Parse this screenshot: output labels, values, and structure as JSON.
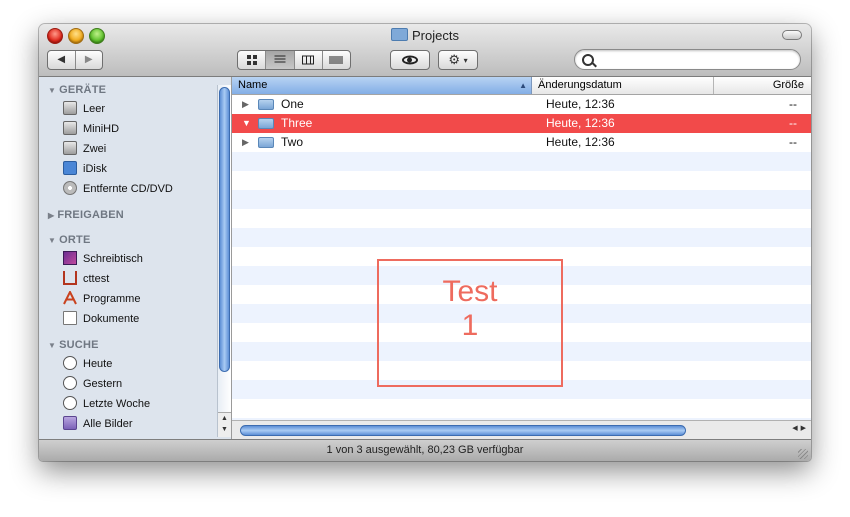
{
  "window": {
    "title": "Projects"
  },
  "toolbar": {
    "back_glyph": "◀",
    "forward_glyph": "▶",
    "action_glyph": "⚙",
    "action_arrow": "▾",
    "search_value": ""
  },
  "sidebar": {
    "sections": [
      {
        "label": "GERÄTE",
        "expanded": true
      },
      {
        "label": "FREIGABEN",
        "expanded": false
      },
      {
        "label": "ORTE",
        "expanded": true
      },
      {
        "label": "SUCHE",
        "expanded": true
      }
    ],
    "devices": [
      "Leer",
      "MiniHD",
      "Zwei",
      "iDisk",
      "Entfernte CD/DVD"
    ],
    "places": [
      "Schreibtisch",
      "cttest",
      "Programme",
      "Dokumente"
    ],
    "searches": [
      "Heute",
      "Gestern",
      "Letzte Woche",
      "Alle Bilder"
    ]
  },
  "list": {
    "columns": {
      "name": "Name",
      "date": "Änderungsdatum",
      "size": "Größe"
    },
    "rows": [
      {
        "name": "One",
        "date": "Heute, 12:36",
        "size": "--",
        "selected": false,
        "expanded": false
      },
      {
        "name": "Three",
        "date": "Heute, 12:36",
        "size": "--",
        "selected": true,
        "expanded": true
      },
      {
        "name": "Two",
        "date": "Heute, 12:36",
        "size": "--",
        "selected": false,
        "expanded": false
      }
    ],
    "selection_color": "#f24a4a"
  },
  "annotation": {
    "line1": "Test",
    "line2": "1",
    "color": "#ee6b5e"
  },
  "status": {
    "text": "1 von 3 ausgewählt, 80,23 GB verfügbar"
  }
}
